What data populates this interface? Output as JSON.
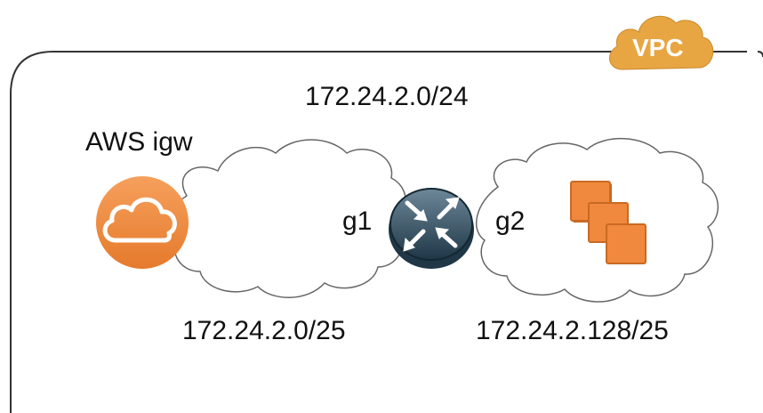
{
  "vpc": {
    "label": "VPC",
    "color": "#e8a642"
  },
  "vpc_cidr": "172.24.2.0/24",
  "igw": {
    "label": "AWS igw",
    "color": "#f0883e"
  },
  "router": {
    "left_interface": "g1",
    "right_interface": "g2",
    "color": "#2b4a5c"
  },
  "subnets": [
    {
      "cidr": "172.24.2.0/25"
    },
    {
      "cidr": "172.24.2.128/25"
    }
  ],
  "instances": {
    "color": "#f0883e",
    "icon": "ec2-instances-icon"
  }
}
